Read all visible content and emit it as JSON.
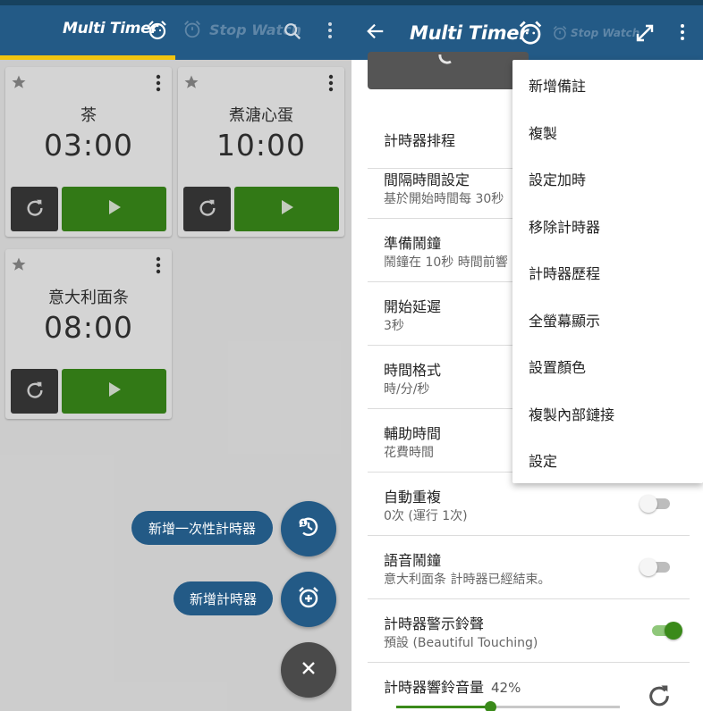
{
  "left": {
    "tabs": {
      "multi_timer": "Multi Timer",
      "stop_watch": "Stop Watch"
    },
    "cards": [
      {
        "name": "茶",
        "time": "03:00"
      },
      {
        "name": "煮溏心蛋",
        "time": "10:00"
      },
      {
        "name": "意大利面条",
        "time": "08:00"
      }
    ],
    "fab": {
      "add_once_label": "新增一次性計時器",
      "add_timer_label": "新增計時器"
    }
  },
  "right": {
    "title": "Multi Timer",
    "stop_watch": "Stop Watch",
    "settings": [
      {
        "title": "計時器排程",
        "subtitle": ""
      },
      {
        "title": "間隔時間設定",
        "subtitle": "基於開始時間每 30秒"
      },
      {
        "title": "準備鬧鐘",
        "subtitle": "鬧鐘在 10秒 時間前響"
      },
      {
        "title": "開始延遲",
        "subtitle": "3秒"
      },
      {
        "title": "時間格式",
        "subtitle": "時/分/秒"
      },
      {
        "title": "輔助時間",
        "subtitle": "花費時間"
      },
      {
        "title": "自動重複",
        "subtitle": "0次 (運行 1次)",
        "toggle": false
      },
      {
        "title": "語音鬧鐘",
        "subtitle": "意大利面条 計時器已經結束。",
        "toggle": false
      },
      {
        "title": "計時器警示鈴聲",
        "subtitle": "預設 (Beautiful Touching)",
        "toggle": true
      },
      {
        "title": "計時器響鈴音量",
        "value": "42%"
      }
    ],
    "volume_fraction": 0.42,
    "menu": [
      "新增備註",
      "複製",
      "設定加時",
      "移除計時器",
      "計時器歷程",
      "全螢幕顯示",
      "設置顏色",
      "複製內部鏈接",
      "設定"
    ]
  },
  "colors": {
    "appbar": "#235a86",
    "accent": "#f1c40f",
    "start_green": "#3a8a1a",
    "reset_dark": "#3a3a3a"
  }
}
